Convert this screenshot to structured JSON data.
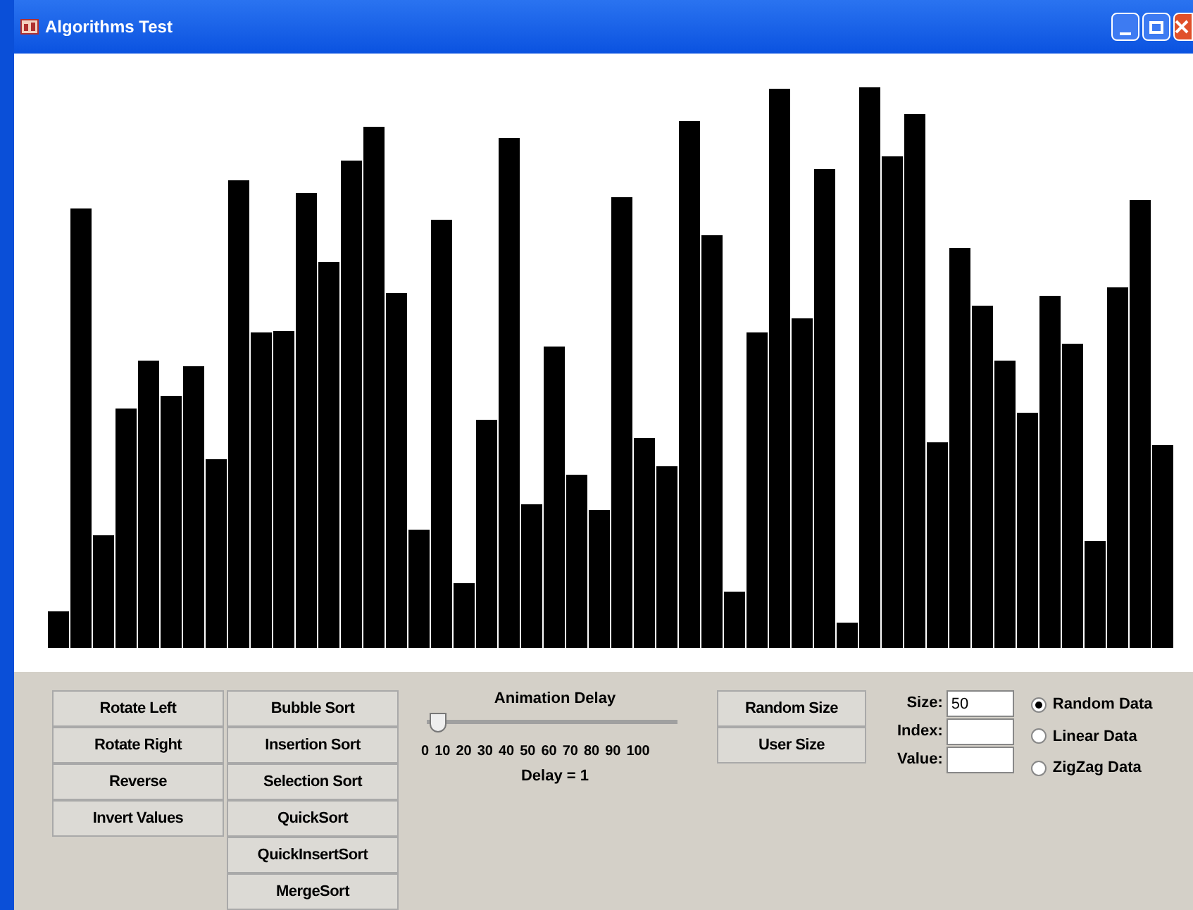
{
  "window": {
    "title": "Algorithms Test"
  },
  "action_buttons": [
    "Rotate Left",
    "Rotate Right",
    "Reverse",
    "Invert Values"
  ],
  "sort_buttons": [
    "Bubble Sort",
    "Insertion Sort",
    "Selection Sort",
    "QuickSort",
    "QuickInsertSort",
    "MergeSort"
  ],
  "slider": {
    "label": "Animation Delay",
    "level": 0.01,
    "ticks": [
      "0",
      "10",
      "20",
      "30",
      "40",
      "50",
      "60",
      "70",
      "80",
      "90",
      "100"
    ],
    "reading": "Delay = 1"
  },
  "size_buttons": [
    "Random Size",
    "User Size"
  ],
  "fields": [
    {
      "label": "Size:",
      "value": "50"
    },
    {
      "label": "Index:"
    },
    {
      "label": "Value:"
    }
  ],
  "data_options": [
    {
      "label": "Random Data",
      "selected": true
    },
    {
      "label": "Linear Data",
      "selected": false
    },
    {
      "label": "ZigZag Data",
      "selected": false
    }
  ]
}
